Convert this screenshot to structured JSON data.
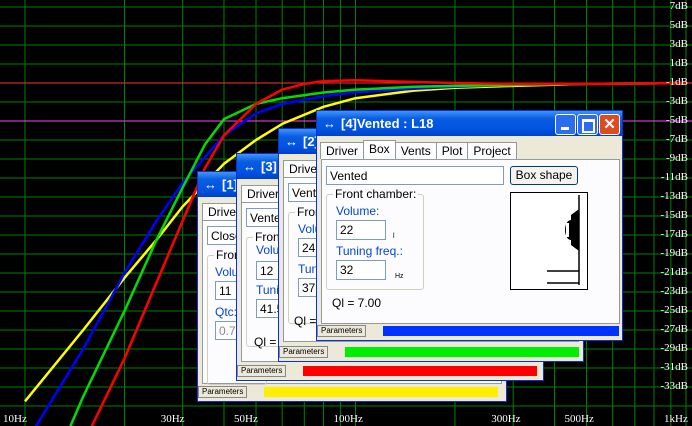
{
  "chart_data": {
    "type": "line",
    "title": "",
    "xlabel": "",
    "ylabel": "",
    "x_scale": "log",
    "xlim": [
      10,
      1000
    ],
    "ylim": [
      -34,
      8
    ],
    "grid": true,
    "y_tick_labels": [
      "7dB",
      "5dB",
      "3dB",
      "1dB",
      "-1dB",
      "-3dB",
      "-5dB",
      "-7dB",
      "-9dB",
      "-11dB",
      "-13dB",
      "-15dB",
      "-17dB",
      "-19dB",
      "-21dB",
      "-23dB",
      "-25dB",
      "-27dB",
      "-29dB",
      "-31dB",
      "-33dB"
    ],
    "x_tick_labels": [
      {
        "x": 10,
        "label": "10Hz"
      },
      {
        "x": 30,
        "label": "30Hz"
      },
      {
        "x": 50,
        "label": "50Hz"
      },
      {
        "x": 100,
        "label": "100Hz"
      },
      {
        "x": 300,
        "label": "300Hz"
      },
      {
        "x": 500,
        "label": "500Hz"
      },
      {
        "x": 1000,
        "label": "1kHz"
      }
    ],
    "reference_lines": [
      {
        "y": 0,
        "color": "#ff3030"
      },
      {
        "y": -4,
        "color": "#ff40ff"
      }
    ],
    "series": [
      {
        "color": "#ffff00",
        "x": [
          10,
          15,
          20,
          25,
          30,
          40,
          50,
          60,
          80,
          100,
          150,
          200,
          300,
          500,
          1000
        ],
        "y": [
          -33.5,
          -26,
          -20.5,
          -16.5,
          -13,
          -8.5,
          -6,
          -4.3,
          -2.5,
          -1.6,
          -0.8,
          -0.5,
          -0.3,
          -0.1,
          0
        ]
      },
      {
        "color": "#0000ff",
        "x": [
          10,
          15,
          20,
          25,
          30,
          40,
          50,
          60,
          80,
          100,
          150,
          200,
          300,
          500,
          1000
        ],
        "y": [
          -38,
          -28,
          -20,
          -14.5,
          -10.5,
          -5.5,
          -3.2,
          -2.2,
          -1.4,
          -1,
          -0.6,
          -0.4,
          -0.2,
          -0.1,
          0
        ]
      },
      {
        "color": "#00dd00",
        "x": [
          13,
          15,
          20,
          25,
          30,
          35,
          40,
          50,
          60,
          80,
          100,
          150,
          200,
          300,
          500,
          1000
        ],
        "y": [
          -38,
          -33,
          -24,
          -16.5,
          -11,
          -6.5,
          -3.8,
          -2.2,
          -1.6,
          -1,
          -0.7,
          -0.4,
          -0.3,
          -0.2,
          -0.1,
          0
        ]
      },
      {
        "color": "#ff0000",
        "x": [
          15,
          20,
          25,
          30,
          35,
          40,
          50,
          60,
          70,
          80,
          100,
          150,
          200,
          300,
          500,
          1000
        ],
        "y": [
          -38,
          -29,
          -21,
          -14.5,
          -9,
          -5.5,
          -2.2,
          -0.7,
          -0.1,
          0.2,
          0.3,
          0.1,
          0,
          -0.1,
          -0.1,
          0
        ]
      }
    ]
  },
  "windows": {
    "w1": {
      "title": "[1]",
      "tab_driver": "Driver",
      "shape_value": "Close",
      "group_title": "Front",
      "volume_label": "Volume",
      "volume_value": "11",
      "extra_label": "Qtc:",
      "extra_value": "0.70",
      "param_label": "Parameters",
      "bar_color": "#ffee00"
    },
    "w3": {
      "title": "[3]",
      "tab_driver": "Driver",
      "shape_value": "Vente",
      "group_title": "Front",
      "volume_label": "Volum",
      "volume_value": "12",
      "tuning_label": "Tunin",
      "tuning_value": "41.5",
      "ql": "Ql = 7",
      "param_label": "Parameters",
      "bar_color": "#ff0000"
    },
    "w2": {
      "title": "[2]",
      "tab_driver": "Driver",
      "shape_value": "Vente",
      "group_title": "Fron",
      "volume_label": "Volum",
      "volume_value": "24",
      "tuning_label": "Tuni",
      "tuning_value": "37",
      "ql": "Ql = 7",
      "param_label": "Parameters",
      "bar_color": "#00ee00"
    },
    "w4": {
      "title": "[4]Vented : L18",
      "tabs": [
        "Driver",
        "Box",
        "Vents",
        "Plot",
        "Project"
      ],
      "active_tab": "Box",
      "shape_value": "Vented",
      "box_shape_button": "Box shape",
      "group_title": "Front chamber:",
      "volume_label": "Volume:",
      "volume_value": "22",
      "volume_unit": "l",
      "tuning_label": "Tuning freq.:",
      "tuning_value": "32",
      "tuning_unit": "Hz",
      "ql": "Ql = 7.00",
      "param_label": "Parameters",
      "bar_color": "#0033ff",
      "title_buttons": [
        "minimize",
        "maximize",
        "close"
      ]
    }
  }
}
